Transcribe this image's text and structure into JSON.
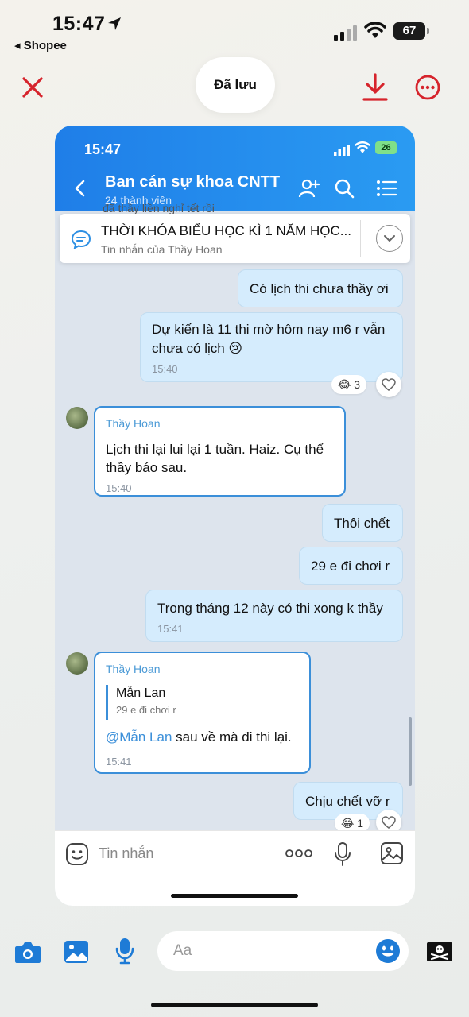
{
  "status_bar": {
    "time": "15:47",
    "back_app": "◂ Shopee",
    "battery": "67"
  },
  "top_actions": {
    "saved_label": "Đã lưu"
  },
  "chat": {
    "status_time": "15:47",
    "battery": "26",
    "title": "Ban cán sự khoa CNTT",
    "subtitle": "24 thành viên",
    "peek_text": "đã thầy liền nghỉ tết rồi",
    "pinned": {
      "title": "THỜI KHÓA BIỂU HỌC KÌ 1 NĂM HỌC...",
      "subtitle": "Tin nhắn của Thầy Hoan"
    },
    "messages": {
      "m1": {
        "text": "Có lịch thi chưa thầy ơi"
      },
      "m2": {
        "line1": "Dự kiến là 11 thi mờ hôm nay m6 r vẫn",
        "line2": "chưa có lịch 😢",
        "time": "15:40",
        "reaction": "😂 3"
      },
      "m3": {
        "sender": "Thầy Hoan",
        "line1": "Lịch thi lại lui lại 1 tuần. Haiz. Cụ thể",
        "line2": "thầy báo sau.",
        "time": "15:40"
      },
      "m4": {
        "text": "Thôi chết"
      },
      "m5": {
        "text": "29 e đi chơi r"
      },
      "m6": {
        "text": "Trong tháng 12 này có thi xong k thầy",
        "time": "15:41"
      },
      "m7": {
        "sender": "Thầy Hoan",
        "quote_name": "Mẫn Lan",
        "quote_text": "29 e đi chơi r",
        "mention": "@Mẫn Lan",
        "text": " sau về mà đi thi lại.",
        "time": "15:41"
      },
      "m8": {
        "text": "Chịu chết vỡ r",
        "reaction": "😂 1"
      }
    },
    "composer": {
      "placeholder": "Tin nhắn"
    }
  },
  "bottom_bar": {
    "placeholder": "Aa"
  }
}
